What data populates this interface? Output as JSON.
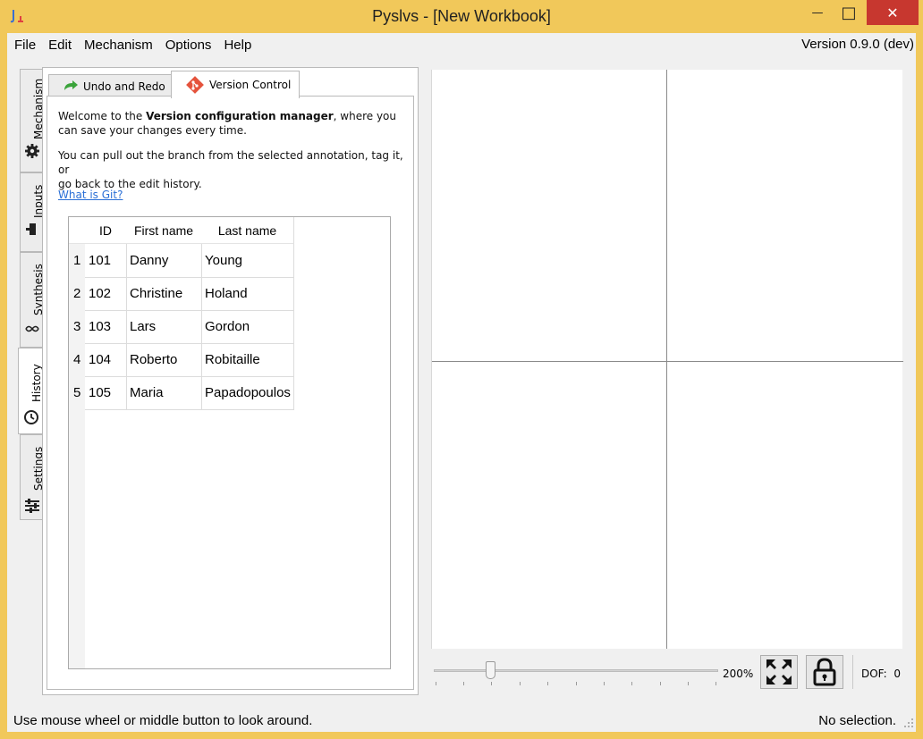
{
  "window": {
    "title": "Pyslvs - [New Workbook]",
    "minimize_glyph": "—",
    "maximize_glyph": "□",
    "close_glyph": "✕"
  },
  "menubar": {
    "items": [
      "File",
      "Edit",
      "Mechanism",
      "Options",
      "Help"
    ],
    "version": "Version 0.9.0 (dev)"
  },
  "side_tabs": [
    {
      "label": "Mechanism",
      "icon": "gear-icon"
    },
    {
      "label": "Inputs",
      "icon": "input-icon"
    },
    {
      "label": "Synthesis",
      "icon": "synthesis-icon"
    },
    {
      "label": "History",
      "icon": "clock-icon",
      "active": true
    },
    {
      "label": "Settings",
      "icon": "sliders-icon"
    }
  ],
  "panel_tabs": [
    {
      "label": "Undo and Redo",
      "icon": "undo-arrow-icon"
    },
    {
      "label": "Version Control",
      "icon": "git-icon",
      "active": true
    }
  ],
  "version_control": {
    "intro_prefix": "Welcome to the ",
    "intro_bold": "Version configuration manager",
    "intro_line1_suffix": ", where you",
    "intro_line2": "can save your changes every time.",
    "branch_line1": "You can pull out the branch from the selected annotation, tag it, or",
    "branch_line2": "go back to the edit history.",
    "git_link": "What is Git?"
  },
  "table": {
    "columns": [
      "ID",
      "First name",
      "Last name"
    ],
    "rows": [
      {
        "num": "1",
        "id": "101",
        "first": "Danny",
        "last": "Young"
      },
      {
        "num": "2",
        "id": "102",
        "first": "Christine",
        "last": "Holand"
      },
      {
        "num": "3",
        "id": "103",
        "first": "Lars",
        "last": "Gordon"
      },
      {
        "num": "4",
        "id": "104",
        "first": "Roberto",
        "last": "Robitaille"
      },
      {
        "num": "5",
        "id": "105",
        "first": "Maria",
        "last": "Papadopoulos"
      }
    ]
  },
  "zoom": {
    "label": "200%"
  },
  "dof": {
    "label": "DOF:",
    "value": "0"
  },
  "status": {
    "left": "Use mouse wheel or middle button to look around.",
    "right": "No selection."
  },
  "colors": {
    "frame": "#f1c85a",
    "close": "#c7372f",
    "link": "#2a6fd6"
  }
}
